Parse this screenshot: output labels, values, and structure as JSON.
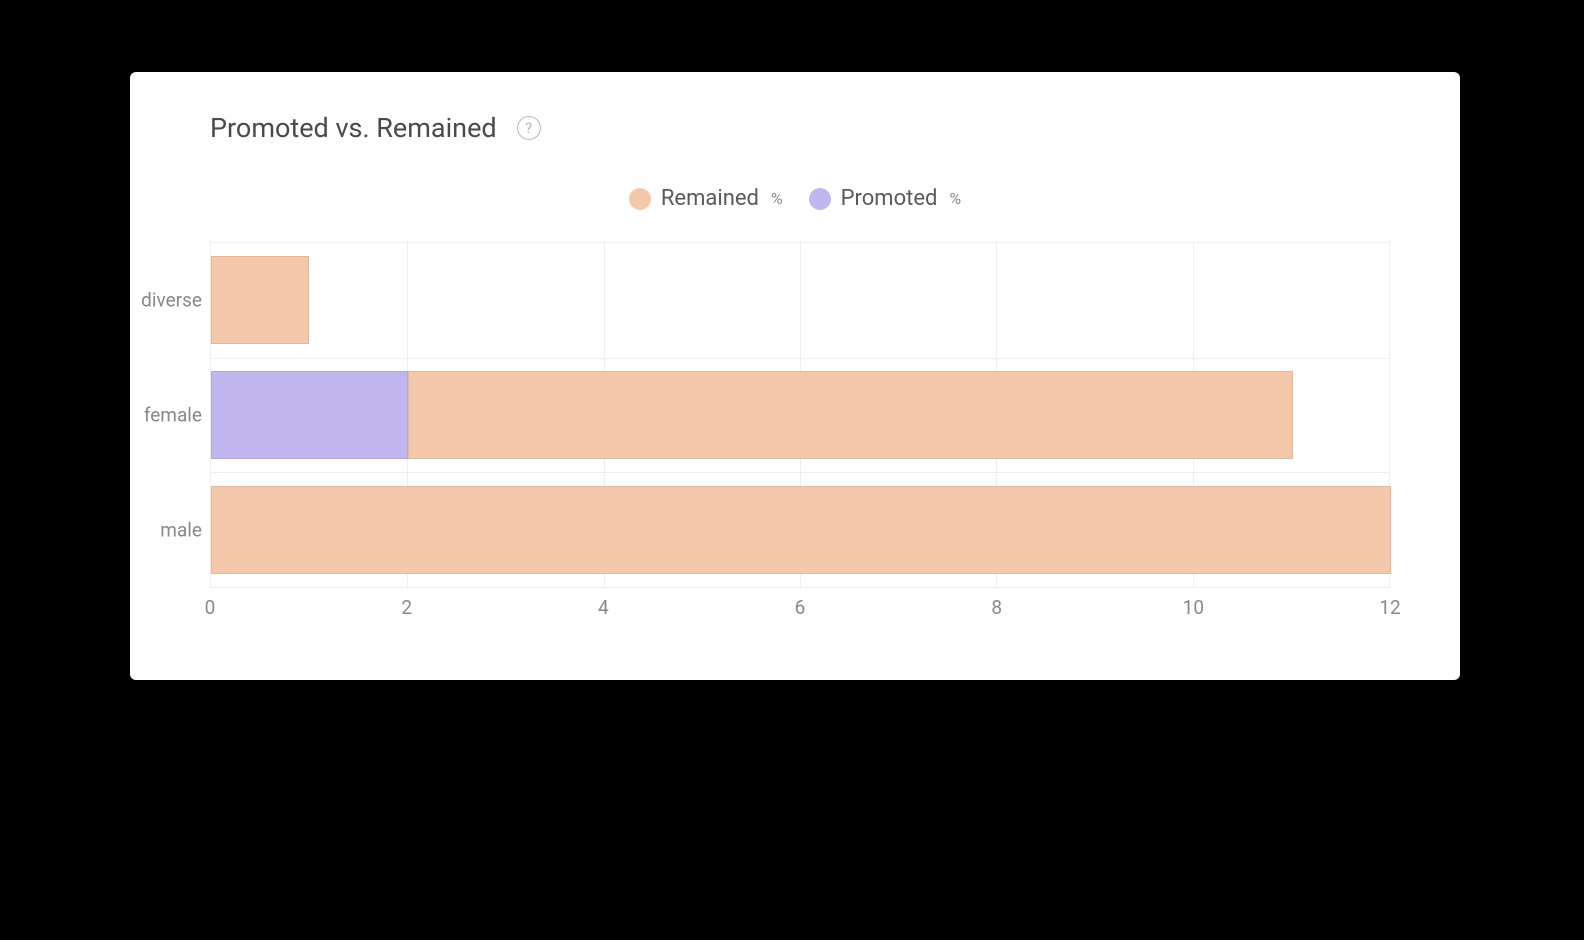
{
  "card": {
    "title": "Promoted vs. Remained"
  },
  "legend": {
    "items": [
      {
        "label": "Remained",
        "suffix": "%",
        "color": "#f4c8ab"
      },
      {
        "label": "Promoted",
        "suffix": "%",
        "color": "#c1b6f0"
      }
    ]
  },
  "x_ticks": [
    "0",
    "2",
    "4",
    "6",
    "8",
    "10",
    "12"
  ],
  "y_categories": [
    "diverse",
    "female",
    "male"
  ],
  "chart_data": {
    "type": "bar",
    "orientation": "horizontal",
    "stacked": true,
    "title": "Promoted vs. Remained",
    "xlabel": "",
    "ylabel": "",
    "xlim": [
      0,
      12
    ],
    "categories": [
      "diverse",
      "female",
      "male"
    ],
    "series": [
      {
        "name": "Promoted",
        "color": "#c1b6f0",
        "values": [
          0,
          2,
          0
        ]
      },
      {
        "name": "Remained",
        "color": "#f4c8ab",
        "values": [
          1,
          9,
          12
        ]
      }
    ],
    "legend_position": "top",
    "grid": true
  }
}
